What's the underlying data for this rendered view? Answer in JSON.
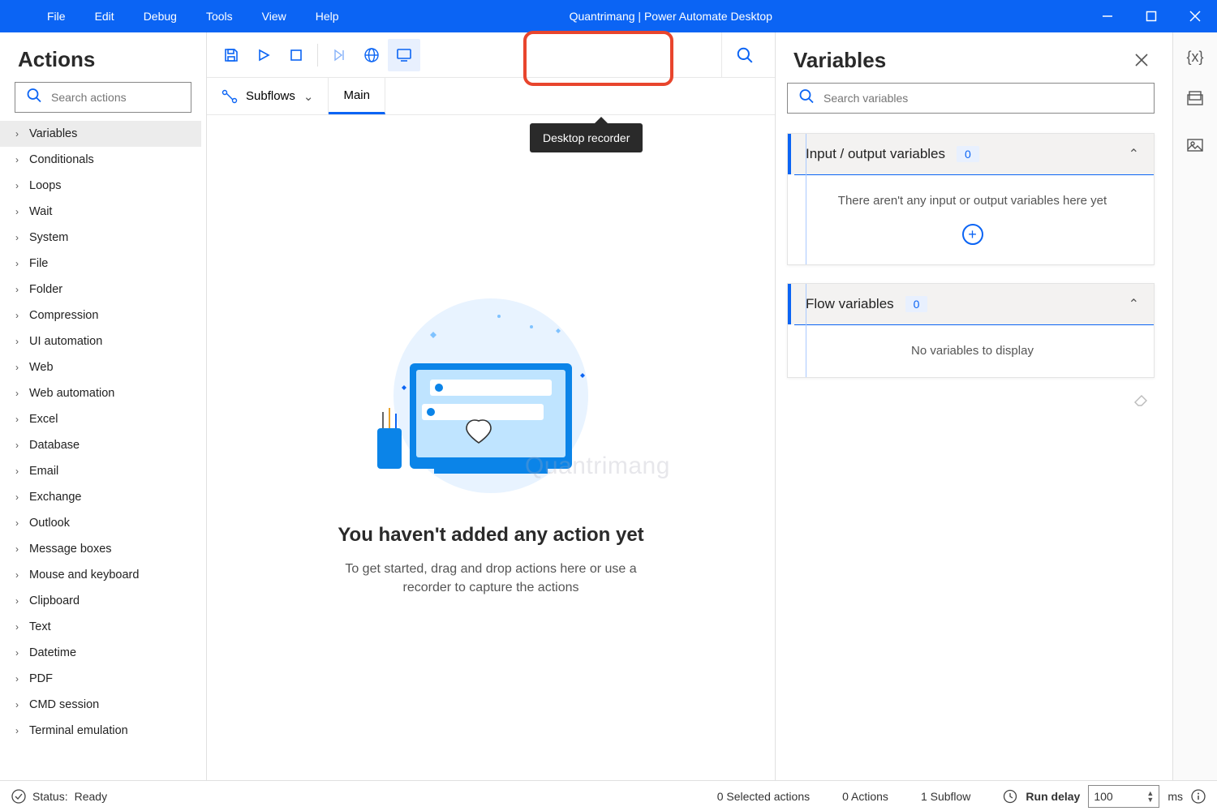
{
  "titlebar": {
    "title": "Quantrimang | Power Automate Desktop",
    "menu": [
      "File",
      "Edit",
      "Debug",
      "Tools",
      "View",
      "Help"
    ]
  },
  "actions": {
    "header": "Actions",
    "search_placeholder": "Search actions",
    "items": [
      "Variables",
      "Conditionals",
      "Loops",
      "Wait",
      "System",
      "File",
      "Folder",
      "Compression",
      "UI automation",
      "Web",
      "Web automation",
      "Excel",
      "Database",
      "Email",
      "Exchange",
      "Outlook",
      "Message boxes",
      "Mouse and keyboard",
      "Clipboard",
      "Text",
      "Datetime",
      "PDF",
      "CMD session",
      "Terminal emulation"
    ]
  },
  "toolbar": {
    "tooltip": "Desktop recorder",
    "subflows_label": "Subflows",
    "main_tab": "Main"
  },
  "empty": {
    "heading": "You haven't added any action yet",
    "sub": "To get started, drag and drop actions here or use a recorder to capture the actions"
  },
  "variables": {
    "header": "Variables",
    "search_placeholder": "Search variables",
    "io_title": "Input / output variables",
    "io_count": "0",
    "io_empty": "There aren't any input or output variables here yet",
    "flow_title": "Flow variables",
    "flow_count": "0",
    "flow_empty": "No variables to display"
  },
  "status": {
    "label_prefix": "Status:",
    "label_value": "Ready",
    "selected": "0 Selected actions",
    "actions": "0 Actions",
    "subflow": "1 Subflow",
    "run_delay_label": "Run delay",
    "run_delay_value": "100",
    "run_delay_unit": "ms"
  },
  "watermark": "Quantrimang"
}
